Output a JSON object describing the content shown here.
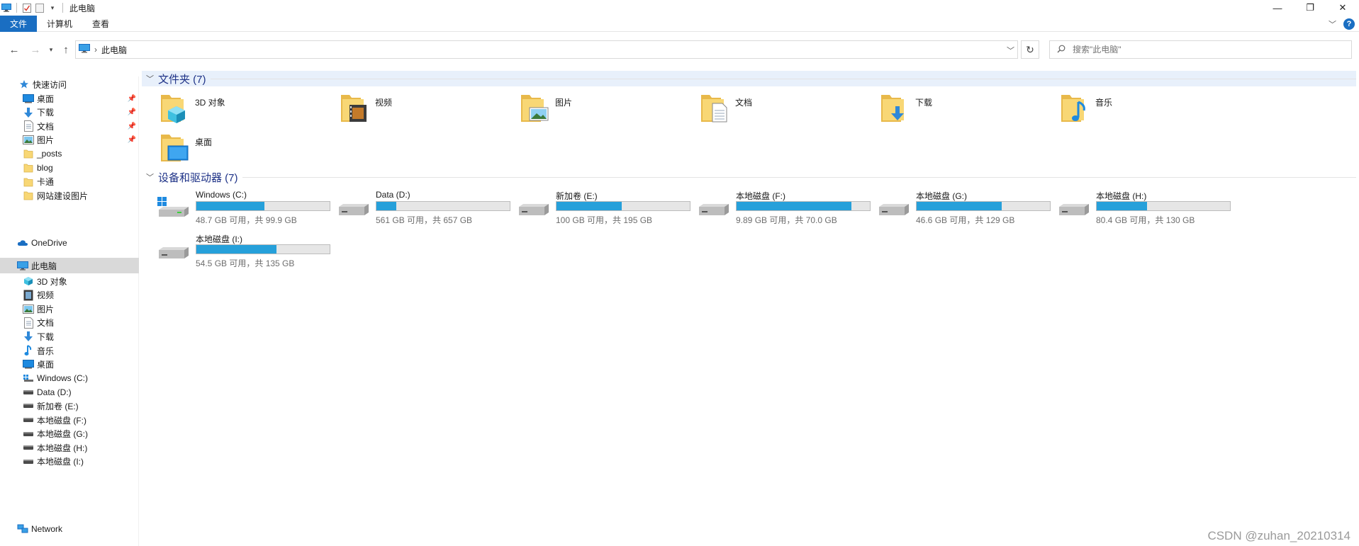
{
  "window": {
    "title": "此电脑",
    "controls": {
      "minimize": "—",
      "restore": "❐",
      "close": "✕"
    }
  },
  "ribbon": {
    "tabs": [
      {
        "label": "文件",
        "active": true
      },
      {
        "label": "计算机",
        "active": false
      },
      {
        "label": "查看",
        "active": false
      }
    ],
    "help": "?",
    "accent": "#1a6ec2"
  },
  "address": {
    "path": "此电脑",
    "search_placeholder": "搜索\"此电脑\""
  },
  "sidebar": {
    "quick_access": "快速访问",
    "quick_items": [
      {
        "label": "桌面",
        "icon": "desktop-icon",
        "pinned": true
      },
      {
        "label": "下载",
        "icon": "download-icon",
        "pinned": true
      },
      {
        "label": "文档",
        "icon": "document-icon",
        "pinned": true
      },
      {
        "label": "图片",
        "icon": "picture-icon",
        "pinned": true
      },
      {
        "label": "_posts",
        "icon": "folder-icon",
        "pinned": false
      },
      {
        "label": "blog",
        "icon": "folder-icon",
        "pinned": false
      },
      {
        "label": "卡通",
        "icon": "folder-icon",
        "pinned": false
      },
      {
        "label": "网站建设图片",
        "icon": "folder-icon",
        "pinned": false
      }
    ],
    "onedrive": "OneDrive",
    "this_pc": "此电脑",
    "pc_items": [
      {
        "label": "3D 对象",
        "icon": "3d-objects-icon"
      },
      {
        "label": "视频",
        "icon": "video-icon"
      },
      {
        "label": "图片",
        "icon": "picture-icon"
      },
      {
        "label": "文档",
        "icon": "document-icon"
      },
      {
        "label": "下载",
        "icon": "download-icon"
      },
      {
        "label": "音乐",
        "icon": "music-icon"
      },
      {
        "label": "桌面",
        "icon": "desktop-icon"
      },
      {
        "label": "Windows (C:)",
        "icon": "windows-drive-icon"
      },
      {
        "label": "Data (D:)",
        "icon": "drive-icon"
      },
      {
        "label": "新加卷 (E:)",
        "icon": "drive-icon"
      },
      {
        "label": "本地磁盘 (F:)",
        "icon": "drive-icon"
      },
      {
        "label": "本地磁盘 (G:)",
        "icon": "drive-icon"
      },
      {
        "label": "本地磁盘 (H:)",
        "icon": "drive-icon"
      },
      {
        "label": "本地磁盘 (I:)",
        "icon": "drive-icon"
      }
    ],
    "network": "Network"
  },
  "content": {
    "folders_header": "文件夹 (7)",
    "folders": [
      {
        "label": "3D 对象",
        "icon": "3d-objects-icon"
      },
      {
        "label": "视频",
        "icon": "video-icon"
      },
      {
        "label": "图片",
        "icon": "picture-icon"
      },
      {
        "label": "文档",
        "icon": "document-icon"
      },
      {
        "label": "下载",
        "icon": "download-icon"
      },
      {
        "label": "音乐",
        "icon": "music-icon"
      },
      {
        "label": "桌面",
        "icon": "desktop-icon"
      }
    ],
    "drives_header": "设备和驱动器 (7)",
    "drives": [
      {
        "label": "Windows (C:)",
        "info": "48.7 GB 可用，共 99.9 GB",
        "used_fraction": 0.51,
        "icon": "windows-drive-icon"
      },
      {
        "label": "Data (D:)",
        "info": "561 GB 可用，共 657 GB",
        "used_fraction": 0.15,
        "icon": "drive-icon"
      },
      {
        "label": "新加卷 (E:)",
        "info": "100 GB 可用，共 195 GB",
        "used_fraction": 0.49,
        "icon": "drive-icon"
      },
      {
        "label": "本地磁盘 (F:)",
        "info": "9.89 GB 可用，共 70.0 GB",
        "used_fraction": 0.86,
        "icon": "drive-icon"
      },
      {
        "label": "本地磁盘 (G:)",
        "info": "46.6 GB 可用，共 129 GB",
        "used_fraction": 0.64,
        "icon": "drive-icon"
      },
      {
        "label": "本地磁盘 (H:)",
        "info": "80.4 GB 可用，共 130 GB",
        "used_fraction": 0.38,
        "icon": "drive-icon"
      },
      {
        "label": "本地磁盘 (I:)",
        "info": "54.5 GB 可用，共 135 GB",
        "used_fraction": 0.6,
        "icon": "drive-icon"
      }
    ],
    "bar_color": "#26a0da"
  },
  "watermark": "CSDN @zuhan_20210314"
}
